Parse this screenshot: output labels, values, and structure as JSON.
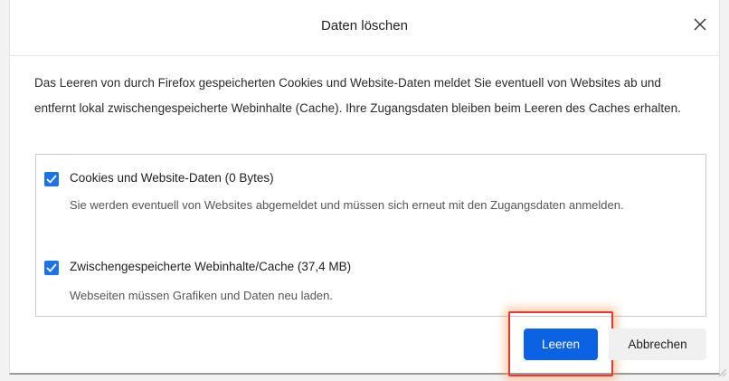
{
  "dialog": {
    "title": "Daten löschen",
    "close_icon": "close-icon",
    "description": "Das Leeren von durch Firefox gespeicherten Cookies und Website-Daten meldet Sie eventuell von Websites ab und entfernt lokal zwischengespeicherte Webinhalte (Cache). Ihre Zugangsdaten bleiben beim Leeren des Caches erhalten."
  },
  "options": [
    {
      "label": "Cookies und Website-Daten (0 Bytes)",
      "description": "Sie werden eventuell von Websites abgemeldet und müssen sich erneut mit den Zugangsdaten anmelden.",
      "checked": true
    },
    {
      "label": "Zwischengespeicherte Webinhalte/Cache (37,4 MB)",
      "description": "Webseiten müssen Grafiken und Daten neu laden.",
      "checked": true
    }
  ],
  "buttons": {
    "primary_label": "Leeren",
    "secondary_label": "Abbrechen"
  },
  "colors": {
    "accent": "#0b62e3",
    "checkbox": "#1a73e8",
    "highlight": "#e53935"
  }
}
